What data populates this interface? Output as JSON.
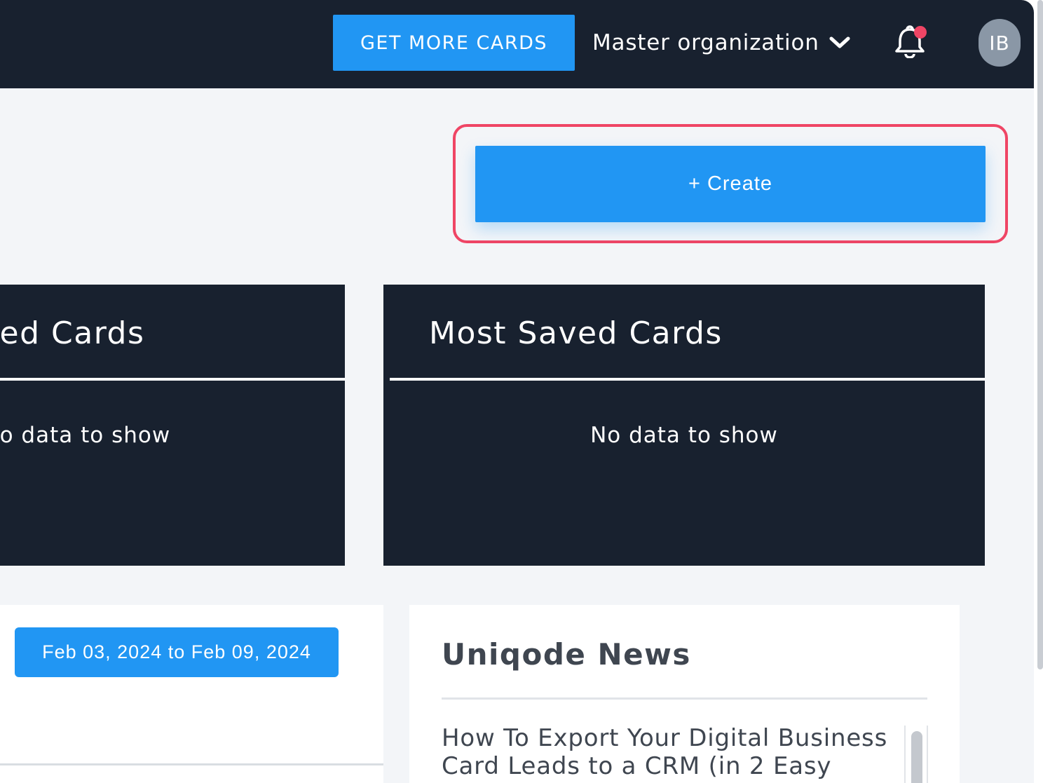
{
  "header": {
    "get_more_cards_label": "GET MORE CARDS",
    "organization": "Master organization",
    "avatar_initials": "IB",
    "notification_dot_color": "#ef4565"
  },
  "actions": {
    "create_label": "+ Create"
  },
  "cards": [
    {
      "title": "ved Cards",
      "empty_text": "lo data to show"
    },
    {
      "title": "Most Saved Cards",
      "empty_text": "No data to show"
    }
  ],
  "date_filter": {
    "range_label": "Feb 03, 2024 to Feb 09, 2024"
  },
  "news": {
    "title": "Uniqode News",
    "items": [
      {
        "headline": "How To Export Your Digital Business Card Leads to a CRM (in 2 Easy"
      }
    ]
  },
  "colors": {
    "header_bg": "#18212f",
    "accent": "#2196f3",
    "highlight": "#ef4565",
    "page_bg": "#f3f5f8"
  }
}
